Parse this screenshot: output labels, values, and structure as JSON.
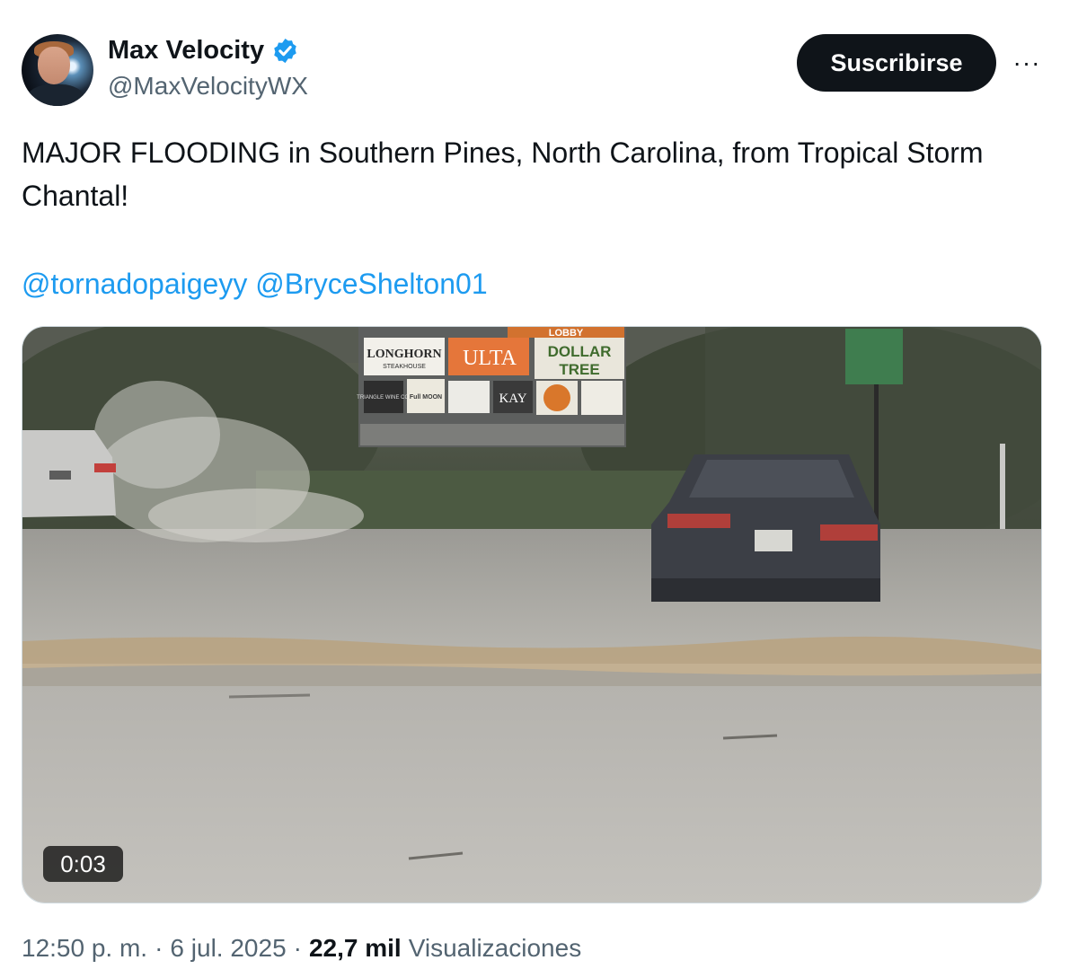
{
  "author": {
    "display_name": "Max Velocity",
    "handle": "@MaxVelocityWX",
    "verified": true,
    "avatar_icon": "profile-photo"
  },
  "actions": {
    "subscribe_label": "Suscribirse",
    "more_label": "···"
  },
  "tweet": {
    "text": "MAJOR FLOODING in Southern Pines, North Carolina, from Tropical Storm Chantal!",
    "mentions": [
      "@tornadopaigeyy",
      "@BryceShelton01"
    ]
  },
  "media": {
    "type": "video",
    "duration": "0:03",
    "sign_labels": {
      "longhorn": "LONGHORN",
      "longhorn_sub": "STEAKHOUSE",
      "ulta": "ULTA",
      "dollar": "DOLLAR",
      "tree": "TREE",
      "triangle": "TRIANGLE WINE CO.",
      "fullmoon": "Full MOON",
      "kay": "KAY",
      "lobby": "LOBBY"
    }
  },
  "meta": {
    "time": "12:50 p. m.",
    "separator": "·",
    "date": "6 jul. 2025",
    "views_count": "22,7 mil",
    "views_label": "Visualizaciones"
  },
  "colors": {
    "link": "#1d9bf0",
    "verified": "#1d9bf0",
    "subscribe_bg": "#0f1419",
    "secondary_text": "#536471"
  }
}
